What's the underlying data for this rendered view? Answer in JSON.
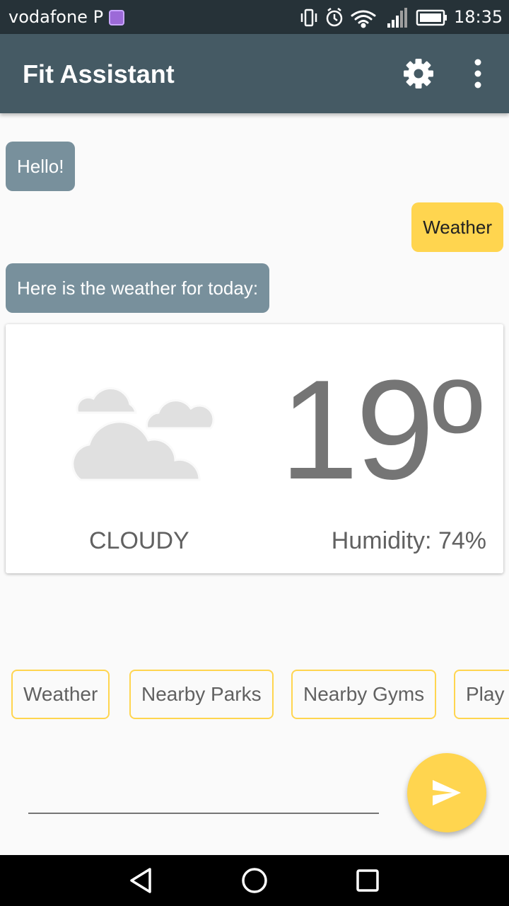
{
  "status_bar": {
    "carrier": "vodafone P",
    "time": "18:35",
    "icons": [
      "vibrate-icon",
      "alarm-icon",
      "wifi-icon",
      "signal-icon",
      "battery-icon"
    ]
  },
  "app_bar": {
    "title": "Fit Assistant",
    "background": "#455a64",
    "icons": [
      "settings-gear-icon",
      "overflow-menu-icon"
    ]
  },
  "chat": {
    "messages": [
      {
        "sender": "bot",
        "text": "Hello!"
      },
      {
        "sender": "user",
        "text": "Weather"
      },
      {
        "sender": "bot",
        "text": "Here is the weather for today:"
      }
    ],
    "bot_bubble_color": "#78909c",
    "user_bubble_color": "#ffd54f"
  },
  "weather_card": {
    "icon": "cloudy-icon",
    "temperature": "19º",
    "condition": "CLOUDY",
    "humidity": "Humidity: 74%"
  },
  "suggestions": [
    "Weather",
    "Nearby Parks",
    "Nearby Gyms",
    "Play"
  ],
  "composer": {
    "input_value": "",
    "send_icon": "send-icon",
    "accent": "#ffd54f"
  },
  "nav_bar": {
    "icons": [
      "back-icon",
      "home-icon",
      "recents-icon"
    ]
  }
}
